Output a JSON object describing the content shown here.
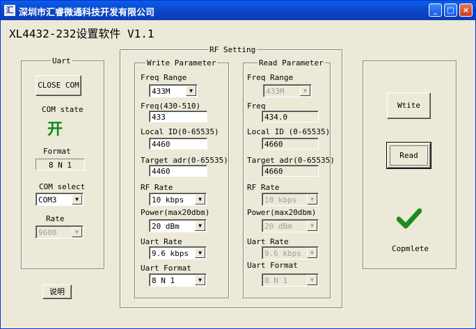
{
  "window": {
    "icon_text": "汇",
    "title": "深圳市汇睿微通科技开发有限公司",
    "minimize": "_",
    "maximize": "□",
    "close": "×"
  },
  "heading": "XL4432-232设置软件 V1.1",
  "uart": {
    "legend": "Uart",
    "close_com": "CLOSE COM",
    "com_state_label": "COM state",
    "com_state_value": "开",
    "format_label": "Format",
    "format_value": "8  N  1",
    "com_select_label": "COM select",
    "com_select_value": "COM3",
    "rate_label": "Rate",
    "rate_value": "9600"
  },
  "help_button": "说明",
  "rf_setting": {
    "legend": "RF Setting"
  },
  "write": {
    "legend": "Write Parameter",
    "freq_range_label": "Freq Range",
    "freq_range_value": "433M",
    "freq_label": "Freq(430-510)",
    "freq_value": "433",
    "local_id_label": "Local ID(0-65535)",
    "local_id_value": "4460",
    "target_label": "Target adr(0-65535)",
    "target_value": "4460",
    "rf_rate_label": "RF Rate",
    "rf_rate_value": "10   kbps",
    "power_label": "Power(max20dbm)",
    "power_value": "20   dBm",
    "uart_rate_label": "Uart Rate",
    "uart_rate_value": "9.6  kbps",
    "uart_format_label": "Uart Format",
    "uart_format_value": "8 N 1"
  },
  "read": {
    "legend": "Read Parameter",
    "freq_range_label": "Freq Range",
    "freq_range_value": "433M",
    "freq_label": "Freq",
    "freq_value": "434.0",
    "local_id_label": "Local ID (0-65535)",
    "local_id_value": "4660",
    "target_label": "Target adr(0-65535)",
    "target_value": "4660",
    "rf_rate_label": "RF Rate",
    "rf_rate_value": "10   kbps",
    "power_label": "Power(max20dbm)",
    "power_value": "20   dBm",
    "uart_rate_label": "Uart Rate",
    "uart_rate_value": "9.6  kbps",
    "uart_format_label": "Uart Format",
    "uart_format_value": "8 N 1"
  },
  "actions": {
    "write_button": "Wtite",
    "read_button": "Read",
    "status_icon": "checkmark-icon",
    "status_text": "Copmlete"
  },
  "colors": {
    "title_bar": "#0b47c9",
    "state_green": "#0a8a1a",
    "check_green": "#1e8a1e"
  }
}
